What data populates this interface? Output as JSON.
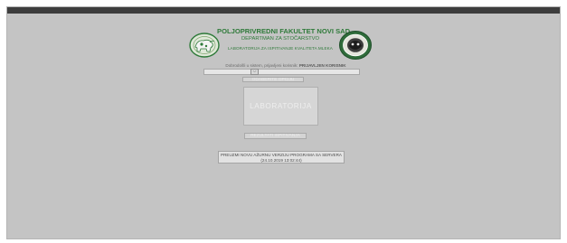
{
  "header": {
    "faculty_name": "POLJOPRIVREDNI FAKULTET NOVI SAD",
    "department": "DEPARTMAN ZA STOČARSTVO",
    "laboratory": "LABORATORIJA ZA ISPITIVANJE KVALITETA MLEKA",
    "logo_left_icon": "cow-silhouette-logo",
    "logo_right_icon": "animals-seal-logo"
  },
  "user": {
    "label": "Dobrodošli u sistem, prijavljeni korisnik:",
    "name": "PRIJAVLJEN KORISNIK"
  },
  "select": {
    "value": "",
    "arrow_icon": "chevron-down-icon"
  },
  "buttons": {
    "top": "ODABERITE OPCIJU",
    "laboratory": "LABORATORIJA",
    "results": "REZULTATI ISPITIVANJA",
    "update_line1": "PREUZMI NOVU AŽURNU VERZIJU PROGRAMA SA SERVERA",
    "update_line2": "(24.10.2019 13:02:44)"
  },
  "colors": {
    "background": "#c4c4c4",
    "title_bar": "#3d3d3d",
    "header_green": "#2f7a3a"
  }
}
